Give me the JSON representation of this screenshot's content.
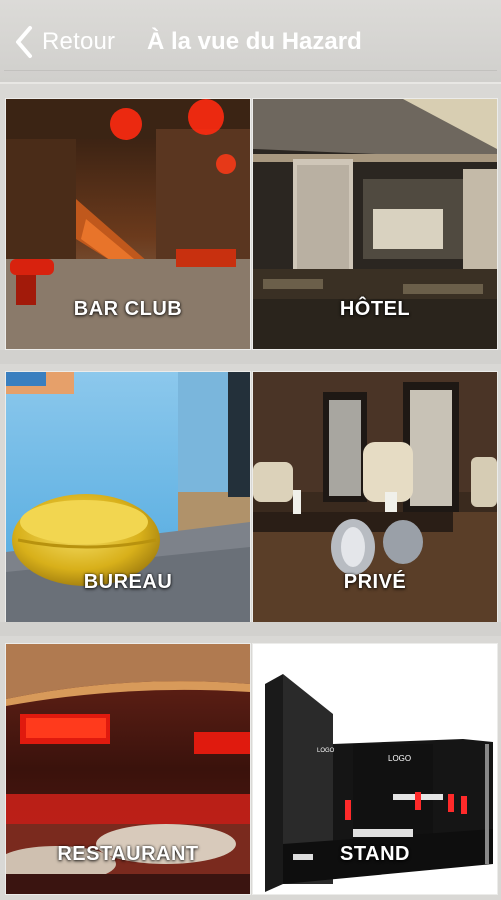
{
  "header": {
    "back_label": "Retour",
    "title": "À la vue du Hazard"
  },
  "tiles": [
    {
      "label": "BAR CLUB"
    },
    {
      "label": "HÔTEL"
    },
    {
      "label": "BUREAU"
    },
    {
      "label": "PRIVÉ"
    },
    {
      "label": "RESTAURANT"
    },
    {
      "label": "STAND"
    }
  ],
  "stand_logo_text": "LOGO"
}
